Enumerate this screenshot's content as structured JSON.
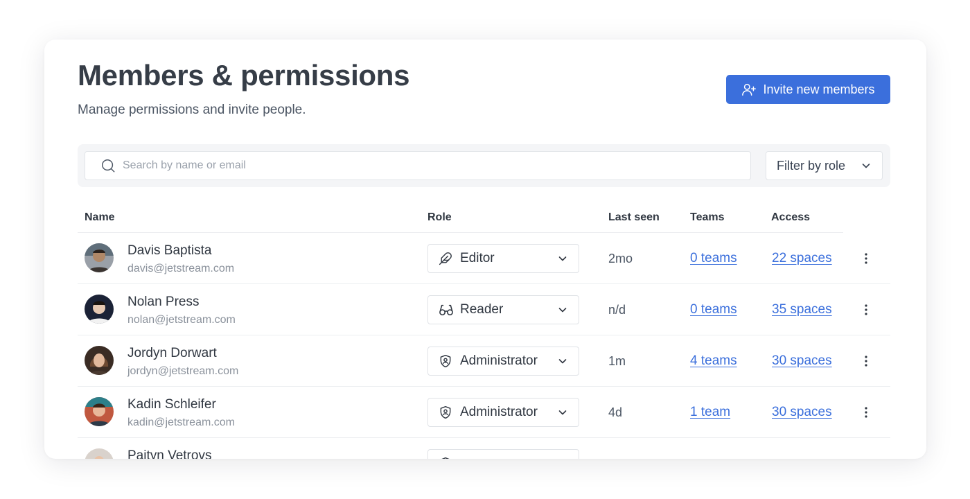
{
  "header": {
    "title": "Members & permissions",
    "subtitle": "Manage permissions and invite people.",
    "invite_label": "Invite new members"
  },
  "filters": {
    "search_placeholder": "Search by name or email",
    "role_filter_label": "Filter by role"
  },
  "table": {
    "columns": {
      "name": "Name",
      "role": "Role",
      "last_seen": "Last seen",
      "teams": "Teams",
      "access": "Access"
    },
    "rows": [
      {
        "name": "Davis Baptista",
        "email": "davis@jetstream.com",
        "role": "Editor",
        "role_icon": "feather-icon",
        "last_seen": "2mo",
        "teams": "0 teams",
        "access": "22 spaces",
        "avatar_color": "#6b5a4e"
      },
      {
        "name": "Nolan Press",
        "email": "nolan@jetstream.com",
        "role": "Reader",
        "role_icon": "glasses-icon",
        "last_seen": "n/d",
        "teams": "0 teams",
        "access": "35 spaces",
        "avatar_color": "#1c2438"
      },
      {
        "name": "Jordyn Dorwart",
        "email": "jordyn@jetstream.com",
        "role": "Administrator",
        "role_icon": "shield-icon",
        "last_seen": "1m",
        "teams": "4 teams",
        "access": "30 spaces",
        "avatar_color": "#5a4436"
      },
      {
        "name": "Kadin Schleifer",
        "email": "kadin@jetstream.com",
        "role": "Administrator",
        "role_icon": "shield-icon",
        "last_seen": "4d",
        "teams": "1 team",
        "access": "30 spaces",
        "avatar_color": "#b0553f"
      },
      {
        "name": "Paityn Vetrovs",
        "email": "",
        "role": "",
        "role_icon": "shield-icon",
        "last_seen": "",
        "teams": "",
        "access": "",
        "avatar_color": "#8a5a48"
      }
    ]
  },
  "colors": {
    "accent": "#3b6fdc",
    "title": "#363d47",
    "muted": "#8a919b"
  }
}
